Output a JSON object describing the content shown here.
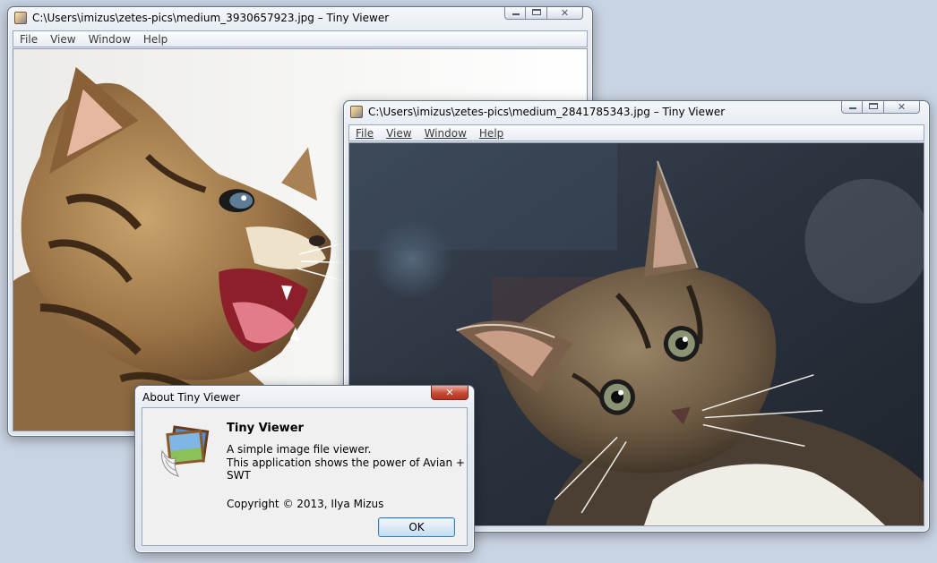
{
  "window1": {
    "title": "C:\\Users\\imizus\\zetes-pics\\medium_3930657923.jpg – Tiny Viewer",
    "menu": [
      "File",
      "View",
      "Window",
      "Help"
    ],
    "photo_icon": "hissing-kitten-photo"
  },
  "window2": {
    "title": "C:\\Users\\imizus\\zetes-pics\\medium_2841785343.jpg – Tiny Viewer",
    "menu": [
      "File",
      "View",
      "Window",
      "Help"
    ],
    "photo_icon": "curious-kitten-photo"
  },
  "about": {
    "title": "About Tiny Viewer",
    "close_label": "✕",
    "app_name": "Tiny Viewer",
    "description_line1": "A simple image file viewer.",
    "description_line2": "This application shows the power of Avian +",
    "description_line3": "SWT",
    "copyright": "Copyright © 2013, Ilya Mizus",
    "ok_label": "OK",
    "icon": "winged-picture-icon"
  },
  "colors": {
    "desktop": "#c9d4e3",
    "window_frame": "#dde4ee",
    "close_button": "#c74a35",
    "ok_border": "#3c7fb1"
  }
}
